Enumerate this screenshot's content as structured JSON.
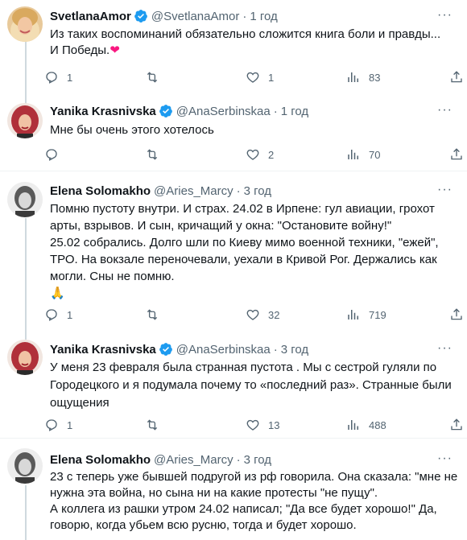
{
  "tweets": [
    {
      "name": "SvetlanaAmor",
      "handle": "@SvetlanaAmor",
      "time": "1 год",
      "verified": true,
      "lines": [
        "Из таких воспоминаний обязательно сложится книга боли и правды...",
        "И Победы."
      ],
      "emoji": "heart",
      "replies": "1",
      "retweets": "",
      "likes": "1",
      "views": "83"
    },
    {
      "name": "Yanika Krasnivska",
      "handle": "@AnaSerbinskaa",
      "time": "1 год",
      "verified": true,
      "lines": [
        "Мне бы очень этого хотелось"
      ],
      "replies": "",
      "retweets": "",
      "likes": "2",
      "views": "70"
    },
    {
      "name": "Elena Solomakho",
      "handle": "@Aries_Marcy",
      "time": "3 год",
      "verified": false,
      "lines": [
        "Помню пустоту внутри. И страх. 24.02 в Ирпене: гул авиации, грохот",
        "арты, взрывов. И сын, кричащий у окна: \"Остановите войну!\"",
        "25.02 собрались. Долго шли по Киеву мимо военной техники, \"ежей\",",
        "ТРО. На вокзале переночевали, уехали в Кривой Рог. Держались как",
        "могли. Сны не помню.",
        "🙏"
      ],
      "replies": "1",
      "retweets": "",
      "likes": "32",
      "views": "719"
    },
    {
      "name": "Yanika Krasnivska",
      "handle": "@AnaSerbinskaa",
      "time": "3 год",
      "verified": true,
      "lines": [
        "У меня 23 февраля была странная пустота . Мы с сестрой гуляли по",
        "Городецкого и я подумала почему то «последний раз». Странные были",
        "ощущения"
      ],
      "replies": "1",
      "retweets": "",
      "likes": "13",
      "views": "488"
    },
    {
      "name": "Elena Solomakho",
      "handle": "@Aries_Marcy",
      "time": "3 год",
      "verified": false,
      "lines": [
        "23 с теперь уже бывшей подругой из рф говорила. Она сказала: \"мне не",
        "нужна эта война, но сына ни на какие протесты \"не пущу\".",
        "А коллега из рашки утром 24.02 написал; \"Да все будет хорошо!\" Да,",
        "говорю, когда убьем всю русню, тогда и будет хорошо."
      ],
      "replies": "",
      "retweets": "",
      "likes": "",
      "views": ""
    }
  ],
  "separator": "·",
  "more_label": "···",
  "colors": {
    "text": "#0f1419",
    "muted": "#536471",
    "verified": "#1d9bf0",
    "divider": "#eff3f4",
    "heart": "#f91880"
  },
  "icons": [
    "reply-icon",
    "retweet-icon",
    "like-icon",
    "views-icon",
    "share-icon",
    "verified-badge-icon",
    "more-icon",
    "red-heart-emoji",
    "folded-hands-emoji"
  ]
}
